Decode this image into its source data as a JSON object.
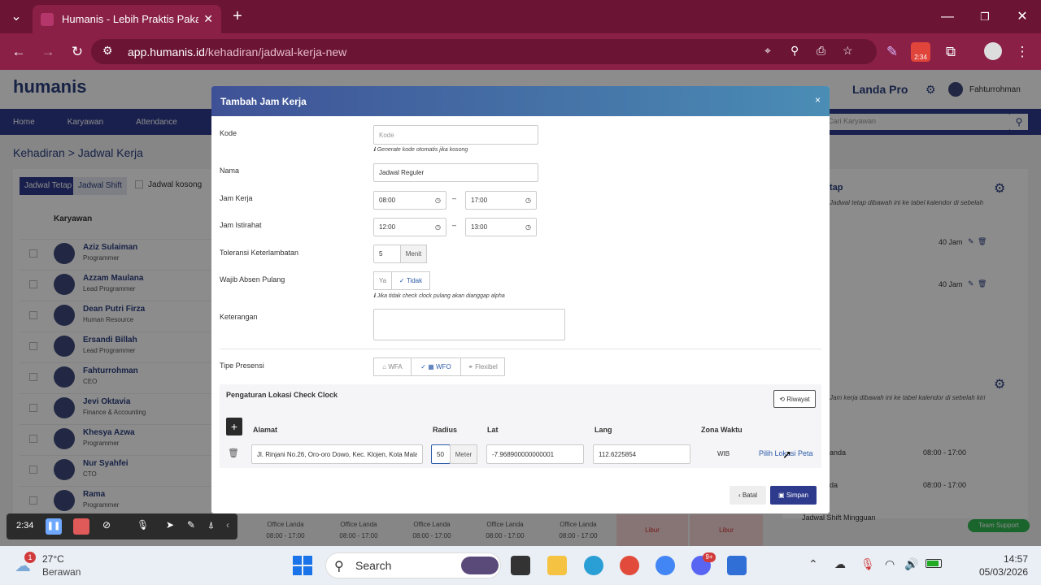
{
  "browser": {
    "tab_title": "Humanis - Lebih Praktis Pakai H",
    "url_host": "app.humanis.id",
    "url_path": "/kehadiran/jadwal-kerja-new",
    "ext_badge": "2:34"
  },
  "app": {
    "logo": "humanis",
    "company": "Landa Pro",
    "user": "Fahturrohman",
    "nav": [
      "Home",
      "Karyawan",
      "Attendance"
    ],
    "search_placeholder": "Cari Karyawan",
    "breadcrumb_root": "Kehadiran",
    "breadcrumb_sep": ">",
    "breadcrumb_page": "Jadwal Kerja",
    "tabs": [
      "Jadwal Tetap",
      "Jadwal Shift"
    ],
    "empty_schedule_label": "Jadwal kosong",
    "employee_header": "Karyawan",
    "employees": [
      {
        "name": "Aziz Sulaiman",
        "role": "Programmer"
      },
      {
        "name": "Azzam Maulana",
        "role": "Lead Programmer"
      },
      {
        "name": "Dean Putri Firza",
        "role": "Human Resource"
      },
      {
        "name": "Ersandi Billah",
        "role": "Lead Programmer"
      },
      {
        "name": "Fahturrohman",
        "role": "CEO"
      },
      {
        "name": "Jevi Oktavia",
        "role": "Finance & Accounting"
      },
      {
        "name": "Khesya Azwa",
        "role": "Programmer"
      },
      {
        "name": "Nur Syahfei",
        "role": "CTO"
      },
      {
        "name": "Rama",
        "role": "Programmer"
      }
    ],
    "right_panel": {
      "title_fragment": "tap",
      "desc1": "Jadwal tetap dibawah ini ke tabel kalendor di sebelah",
      "hours": [
        "40 Jam",
        "40 Jam"
      ],
      "desc2": "Jam kerja dibawah ini ke tabel kalendor di sebelah kiri",
      "rows": [
        {
          "label": "anda",
          "time": "08:00 - 17:00"
        },
        {
          "label": "da",
          "time": "08:00 - 17:00"
        }
      ],
      "weekly": "Jadwal Shift Mingguan",
      "support": "Team Support"
    },
    "calendar_strip": [
      {
        "label": "Office Landa",
        "time": "08:00 - 17:00"
      },
      {
        "label": "Office Landa",
        "time": "08:00 - 17:00"
      },
      {
        "label": "Office Landa",
        "time": "08:00 - 17:00"
      },
      {
        "label": "Office Landa",
        "time": "08:00 - 17:00"
      },
      {
        "label": "Office Landa",
        "time": "08:00 - 17:00"
      },
      {
        "label": "Libur",
        "time": ""
      },
      {
        "label": "Libur",
        "time": ""
      }
    ]
  },
  "modal": {
    "title": "Tambah Jam Kerja",
    "close": "×",
    "kode_label": "Kode",
    "kode_placeholder": "Kode",
    "kode_hint": "Generate kode otomatis jika kosong",
    "nama_label": "Nama",
    "nama_value": "Jadwal Reguler",
    "jam_kerja_label": "Jam Kerja",
    "jam_kerja_start": "08:00",
    "jam_kerja_end": "17:00",
    "jam_istirahat_label": "Jam Istirahat",
    "jam_istirahat_start": "12:00",
    "jam_istirahat_end": "13:00",
    "dash": "–",
    "toleransi_label": "Toleransi Keterlambatan",
    "toleransi_value": "5",
    "toleransi_unit": "Menit",
    "wajib_label": "Wajib Absen Pulang",
    "wajib_ya": "Ya",
    "wajib_tidak": "Tidak",
    "wajib_hint": "Jika tidak check clock pulang akan dianggap alpha",
    "keterangan_label": "Keterangan",
    "keterangan_value": "",
    "tipe_label": "Tipe Presensi",
    "tipe_wfa": "WFA",
    "tipe_wfo": "WFO",
    "tipe_flexibel": "Flexibel",
    "lokasi_title": "Pengaturan Lokasi Check Clock",
    "riwayat": "Riwayat",
    "columns": {
      "alamat": "Alamat",
      "radius": "Radius",
      "lat": "Lat",
      "lang": "Lang",
      "zona": "Zona Waktu"
    },
    "row": {
      "alamat": "Jl. Rinjani No.26, Oro-oro Dowo, Kec. Klojen, Kota Mala",
      "radius": "50",
      "radius_unit": "Meter",
      "lat": "-7.968900000000001",
      "lang": "112.6225854",
      "zona": "WIB",
      "pilih": "Pilih Lokasi Peta"
    },
    "batal": "Batal",
    "simpan": "Simpan"
  },
  "recorder": {
    "time": "2:34"
  },
  "taskbar": {
    "weather_temp": "27°C",
    "weather_desc": "Berawan",
    "weather_badge": "1",
    "search_label": "Search",
    "discord_badge": "9+",
    "time": "14:57",
    "date": "05/03/2026"
  }
}
